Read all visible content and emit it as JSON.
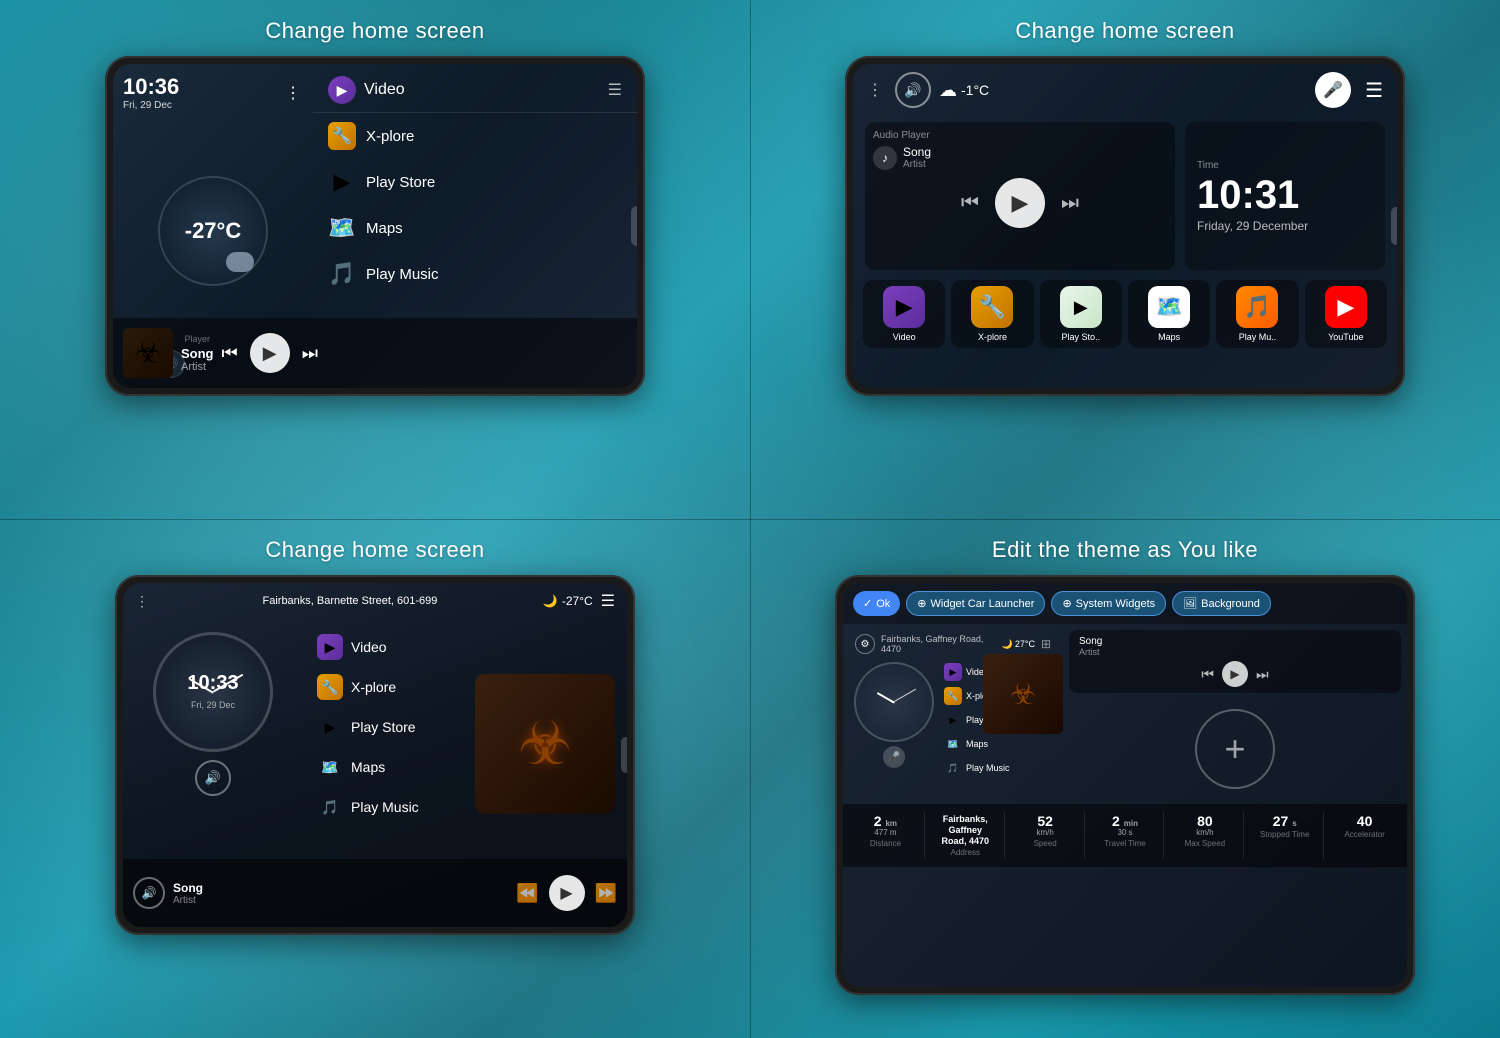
{
  "titles": {
    "top_left": "Change home screen",
    "top_right": "Change home screen",
    "bottom_left": "Change home screen",
    "bottom_right": "Edit the theme as You like"
  },
  "screen1": {
    "time": "10:36",
    "date": "Fri, 29 Dec",
    "temp": "-27°C",
    "menu_title": "Video",
    "items": [
      {
        "label": "X-plore",
        "icon": "📁"
      },
      {
        "label": "Play Store",
        "icon": "▶"
      },
      {
        "label": "Maps",
        "icon": "📍"
      },
      {
        "label": "Play Music",
        "icon": "🎵"
      }
    ],
    "player_section": "Player",
    "song": "Song",
    "artist": "Artist"
  },
  "screen2": {
    "temp": "-1°C",
    "time": "10:31",
    "date": "Friday, 29 December",
    "song": "Song",
    "artist": "Artist",
    "audio_label": "Audio Player",
    "time_label": "Time",
    "apps": [
      {
        "label": "Video"
      },
      {
        "label": "X-plore"
      },
      {
        "label": "Play Sto.."
      },
      {
        "label": "Maps"
      },
      {
        "label": "Play Mu.."
      },
      {
        "label": "YouTube"
      }
    ]
  },
  "screen3": {
    "address": "Fairbanks, Barnette Street, 601-699",
    "temp": "-27°C",
    "time": "10:33",
    "date": "Fri, 29 Dec",
    "items": [
      {
        "label": "Video"
      },
      {
        "label": "X-plore"
      },
      {
        "label": "Play Store"
      },
      {
        "label": "Maps"
      },
      {
        "label": "Play Music"
      }
    ],
    "song": "Song",
    "artist": "Artist"
  },
  "screen4": {
    "toolbar": {
      "ok": "Ok",
      "widget": "Widget Car Launcher",
      "system": "System Widgets",
      "background": "Background"
    },
    "address": "Fairbanks, Gaffney Road, 4470",
    "temp": "27°C",
    "items": [
      {
        "label": "Video"
      },
      {
        "label": "X-plore"
      },
      {
        "label": "Play Store"
      },
      {
        "label": "Maps"
      },
      {
        "label": "Play Music"
      }
    ],
    "song": "Song",
    "artist": "Artist",
    "stats": [
      {
        "value": "2",
        "unit": "km",
        "sub": "477 m",
        "label": "Distance"
      },
      {
        "value": "Fairbanks,",
        "unit": "Gaffney",
        "sub": "Road, 4470",
        "label": "Address"
      },
      {
        "value": "52",
        "unit": "km/h",
        "sub": "",
        "label": "Speed"
      },
      {
        "value": "2",
        "unit": "min",
        "sub": "30 s",
        "label": "Travel Time"
      },
      {
        "value": "80",
        "unit": "km/h",
        "sub": "",
        "label": "Max Speed"
      },
      {
        "value": "27",
        "unit": "s",
        "sub": "",
        "label": "Stopped Time"
      },
      {
        "value": "40",
        "unit": "",
        "sub": "",
        "label": "Accelerator"
      }
    ]
  }
}
